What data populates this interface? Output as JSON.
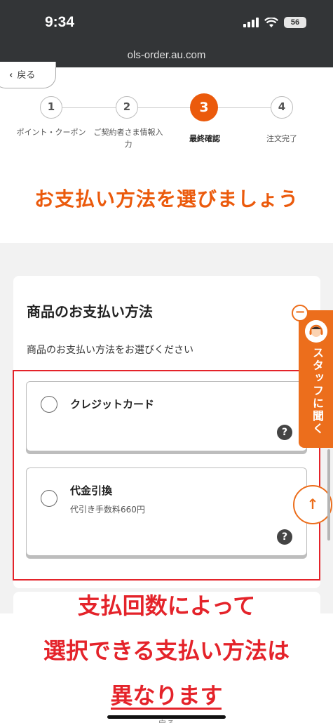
{
  "status_bar": {
    "time": "9:34",
    "battery": "56"
  },
  "url": "ols-order.au.com",
  "back_button": "戻る",
  "stepper": [
    {
      "number": "1",
      "label": "ポイント・クーポン"
    },
    {
      "number": "2",
      "label": "ご契約者さま情報入力"
    },
    {
      "number": "3",
      "label": "最終確認"
    },
    {
      "number": "4",
      "label": "注文完了"
    }
  ],
  "active_step": 3,
  "page_heading": "お支払い方法を選びましょう",
  "payment": {
    "title": "商品のお支払い方法",
    "subtitle": "商品のお支払い方法をお選びください",
    "options": [
      {
        "label": "クレジットカード",
        "note": "",
        "help": "?"
      },
      {
        "label": "代金引換",
        "note": "代引き手数料660円",
        "help": "?"
      }
    ]
  },
  "staff_tab": {
    "label": "スタッフに聞く",
    "collapse": "−"
  },
  "scroll_top": "↑",
  "caption": {
    "line1": "支払回数によって",
    "line2": "選択できる支払い方法は",
    "line3": "異なります"
  },
  "bottom_back": "戻る",
  "colors": {
    "accent": "#eb5a0c",
    "annotation": "#e4232a"
  }
}
